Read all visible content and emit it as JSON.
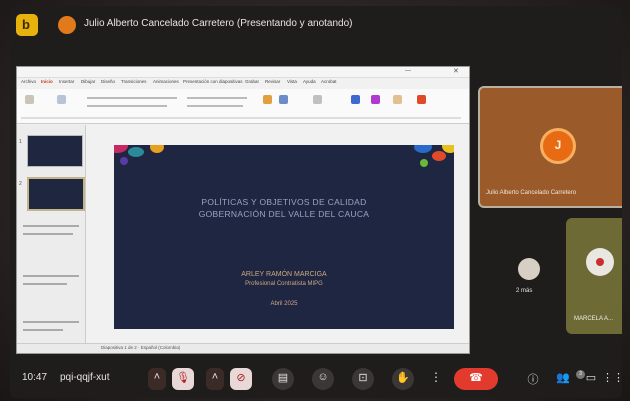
{
  "app": {
    "presenter_initial": "J",
    "presenter_title": "Julio Alberto Cancelado Carretero (Presentando y anotando)"
  },
  "ppt": {
    "tabs": [
      "Archivo",
      "Inicio",
      "Insertar",
      "Dibujar",
      "Diseño",
      "Transiciones",
      "Animaciones",
      "Presentación con diapositivas",
      "Grabar",
      "Revisar",
      "Vista",
      "Ayuda",
      "Acrobat"
    ],
    "active_tab_index": 1,
    "thumbnail_numbers": [
      "1",
      "2"
    ],
    "status_text": "Diapositiva 1 de 2 · Español (Colombia)"
  },
  "slide": {
    "line1": "POLÍTICAS Y OBJETIVOS DE CALIDAD",
    "line2": "GOBERNACIÓN DEL VALLE DEL CAUCA",
    "author": "ARLEY RAMÓN MARCIGA",
    "role": "Profesional Contratista MIPG",
    "date": "Abril 2025"
  },
  "participants": {
    "main_initial": "J",
    "main_name": "Julio Alberto Cancelado Carretero",
    "others_label": "2 más",
    "marcela_name": "MARCELA A..."
  },
  "bottom": {
    "time": "10:47",
    "code": "pqi-qqjf-xut",
    "badge": "3"
  },
  "icons": {
    "app_logo": "meet-logo-icon",
    "mic_off": "mic-off-icon",
    "cam_off": "camera-off-icon",
    "captions": "captions-icon",
    "emoji": "emoji-icon",
    "present": "present-icon",
    "hand": "raise-hand-icon",
    "end": "end-call-icon",
    "info": "info-icon",
    "people": "people-icon",
    "chat": "chat-icon",
    "activities": "activities-icon"
  },
  "colors": {
    "end_call": "#e23a2c",
    "slide_bg": "#1e2642",
    "tile_accent": "#e86a12"
  }
}
